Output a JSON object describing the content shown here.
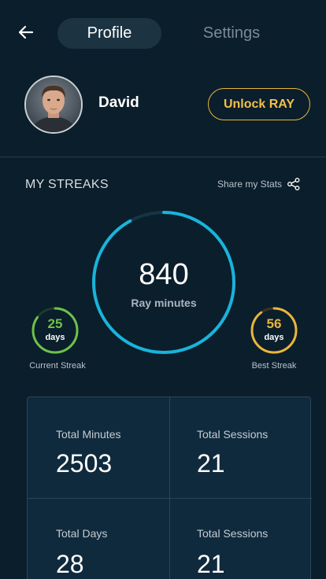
{
  "nav": {
    "tabs": [
      {
        "label": "Profile",
        "active": true
      },
      {
        "label": "Settings",
        "active": false
      }
    ]
  },
  "profile": {
    "name": "David",
    "unlock_label": "Unlock RAY"
  },
  "streaks": {
    "title": "MY STREAKS",
    "share_label": "Share my Stats",
    "total": {
      "value": "840",
      "label": "Ray minutes",
      "progress": 0.92
    },
    "current": {
      "value": "25",
      "unit": "days",
      "label": "Current Streak",
      "progress": 0.85
    },
    "best": {
      "value": "56",
      "unit": "days",
      "label": "Best Streak",
      "progress": 0.9
    }
  },
  "stats": [
    {
      "label": "Total Minutes",
      "value": "2503"
    },
    {
      "label": "Total Sessions",
      "value": "21"
    },
    {
      "label": "Total Days",
      "value": "28"
    },
    {
      "label": "Total Sessions",
      "value": "21"
    }
  ],
  "colors": {
    "background": "#0b1e2b",
    "accent_blue": "#18b4dc",
    "accent_green": "#6cc24a",
    "accent_yellow": "#e8b63b"
  }
}
